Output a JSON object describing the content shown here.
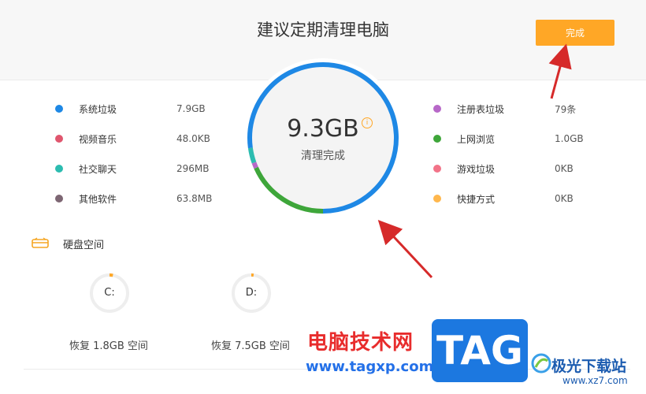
{
  "header": {
    "title": "建议定期清理电脑",
    "done_label": "完成"
  },
  "summary": {
    "size": "9.3GB",
    "status": "清理完成",
    "info_icon": "info-icon"
  },
  "categories_left": [
    {
      "label": "系统垃圾",
      "value": "7.9GB",
      "color": "#1e88e5"
    },
    {
      "label": "视频音乐",
      "value": "48.0KB",
      "color": "#e0566e"
    },
    {
      "label": "社交聊天",
      "value": "296MB",
      "color": "#2cbcb0"
    },
    {
      "label": "其他软件",
      "value": "63.8MB",
      "color": "#7d6673"
    }
  ],
  "categories_right": [
    {
      "label": "注册表垃圾",
      "value": "79条",
      "color": "#b768c8"
    },
    {
      "label": "上网浏览",
      "value": "1.0GB",
      "color": "#3ea63a"
    },
    {
      "label": "游戏垃圾",
      "value": "0KB",
      "color": "#f27388"
    },
    {
      "label": "快捷方式",
      "value": "0KB",
      "color": "#ffb74d"
    }
  ],
  "ring_segments": [
    {
      "name": "系统垃圾",
      "fraction": 0.772,
      "color": "#1e88e5"
    },
    {
      "name": "社交聊天",
      "fraction": 0.033,
      "color": "#2cbcb0"
    },
    {
      "name": "注册表垃圾",
      "fraction": 0.012,
      "color": "#b768c8"
    },
    {
      "name": "上网浏览",
      "fraction": 0.183,
      "color": "#3ea63a"
    }
  ],
  "disk": {
    "title": "硬盘空间",
    "icon": "hard-drive-icon",
    "drives": [
      {
        "letter": "C:",
        "recovered": "恢复 1.8GB 空间",
        "used_fraction": 0.03
      },
      {
        "letter": "D:",
        "recovered": "恢复 7.5GB 空间",
        "used_fraction": 0.02
      }
    ]
  },
  "watermark": {
    "site_name": "电脑技术网",
    "site_url": "www.tagxp.com",
    "logo_text": "TAG",
    "brand": "极光下载站",
    "brand_url": "www.xz7.com"
  },
  "colors": {
    "accent": "#ffa726",
    "ring_track": "#1e88e5",
    "arrow": "#d62a2a"
  }
}
